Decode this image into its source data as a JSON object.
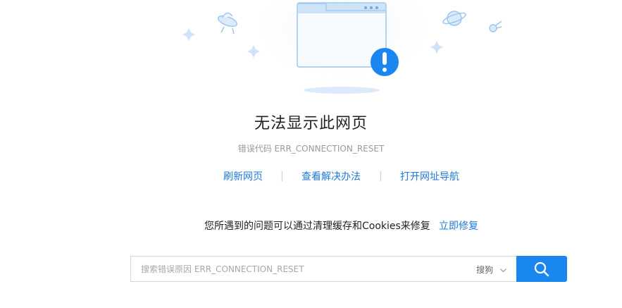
{
  "page": {
    "title": "无法显示此网页",
    "error_code": "错误代码 ERR_CONNECTION_RESET"
  },
  "actions": {
    "refresh": "刷新网页",
    "view_solution": "查看解决办法",
    "open_nav": "打开网址导航",
    "separator": "|"
  },
  "fix": {
    "text": "您所遇到的问题可以通过清理缓存和Cookies来修复",
    "link": "立即修复"
  },
  "search": {
    "placeholder": "搜索错误原因 ERR_CONNECTION_RESET",
    "engine": "搜狗"
  },
  "colors": {
    "link": "#1e7ad7",
    "accent": "#1a87f0",
    "illustration": "#cfe3f8"
  },
  "icons": [
    "ufo-icon",
    "planet-icon",
    "comet-icon",
    "sparkle-icon",
    "browser-window-icon",
    "alert-icon",
    "search-icon",
    "chevron-down-icon"
  ]
}
